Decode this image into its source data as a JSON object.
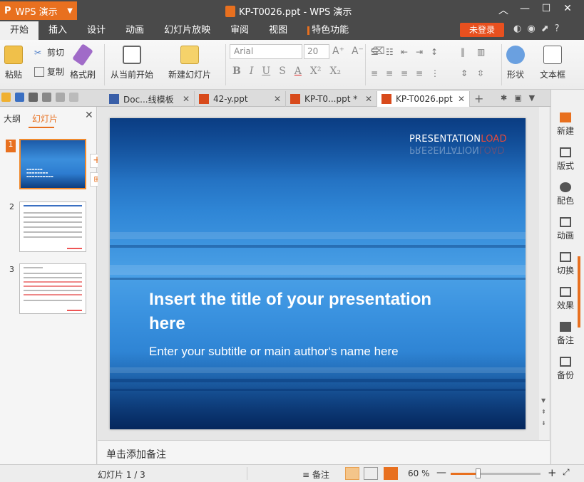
{
  "app": {
    "name": "WPS 演示",
    "window_title": "KP-T0026.ppt - WPS 演示",
    "login_label": "未登录"
  },
  "menu_tabs": [
    {
      "label": "开始"
    },
    {
      "label": "插入"
    },
    {
      "label": "设计"
    },
    {
      "label": "动画"
    },
    {
      "label": "幻灯片放映"
    },
    {
      "label": "审阅"
    },
    {
      "label": "视图"
    },
    {
      "label": "特色功能"
    }
  ],
  "ribbon": {
    "paste": "粘贴",
    "cut": "剪切",
    "copy": "复制",
    "format_painter": "格式刷",
    "from_current": "从当前开始",
    "new_slide": "新建幻灯片",
    "font_name": "Arial",
    "font_size": "20",
    "shape": "形状",
    "textbox": "文本框",
    "bold": "B",
    "italic": "I",
    "underline": "U",
    "strike": "S",
    "font_color": "A",
    "superscript": "X²",
    "subscript": "X₂"
  },
  "doc_tabs": [
    {
      "label": "Doc...线模板"
    },
    {
      "label": "42-y.ppt"
    },
    {
      "label": "KP-T0...ppt *"
    },
    {
      "label": "KP-T0026.ppt"
    }
  ],
  "left_panel": {
    "tab_outline": "大纲",
    "tab_slides": "幻灯片",
    "slide_numbers": [
      "1",
      "2",
      "3"
    ]
  },
  "slide": {
    "brand_a": "PRESENTATION",
    "brand_b": "LOAD",
    "title": "Insert the title of your presentation here",
    "subtitle": "Enter your subtitle or main author‘s name here"
  },
  "right_sidebar": [
    {
      "label": "新建"
    },
    {
      "label": "版式"
    },
    {
      "label": "配色"
    },
    {
      "label": "动画"
    },
    {
      "label": "切换"
    },
    {
      "label": "效果"
    },
    {
      "label": "备注"
    },
    {
      "label": "备份"
    }
  ],
  "notes_placeholder": "单击添加备注",
  "status": {
    "page": "幻灯片 1 / 3",
    "notes": "备注",
    "zoom": "60 %",
    "zoom_fraction": 0.3
  },
  "colors": {
    "accent": "#e8701f",
    "titlebar": "#4a4a4a"
  }
}
